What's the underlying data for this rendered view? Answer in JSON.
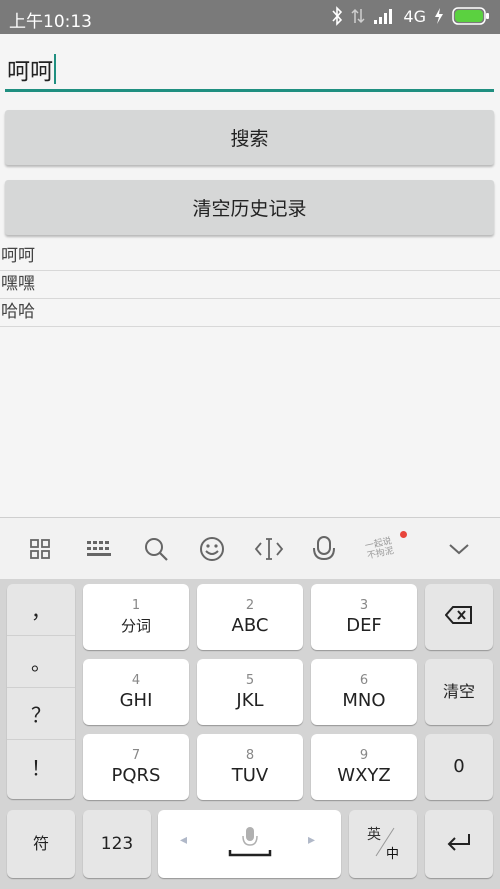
{
  "status_bar": {
    "time": "上午10:13",
    "network": "4G"
  },
  "search": {
    "value": "呵呵"
  },
  "buttons": {
    "search": "搜索",
    "clear_history": "清空历史记录"
  },
  "history": [
    "呵呵",
    "嘿嘿",
    "哈哈"
  ],
  "keyboard": {
    "toolbar_icons": [
      "grid-icon",
      "keyboard-icon",
      "search-icon",
      "emoji-icon",
      "cursor-icon",
      "microphone-icon",
      "handwriting-icon",
      "collapse-chevron-icon"
    ],
    "handwriting_hint": [
      "一起说",
      "不拘泥"
    ],
    "punctuation": [
      "，",
      "。",
      "？",
      "！"
    ],
    "keys": [
      {
        "num": "1",
        "label": "分词"
      },
      {
        "num": "2",
        "label": "ABC"
      },
      {
        "num": "3",
        "label": "DEF"
      },
      {
        "num": "4",
        "label": "GHI"
      },
      {
        "num": "5",
        "label": "JKL"
      },
      {
        "num": "6",
        "label": "MNO"
      },
      {
        "num": "7",
        "label": "PQRS"
      },
      {
        "num": "8",
        "label": "TUV"
      },
      {
        "num": "9",
        "label": "WXYZ"
      }
    ],
    "clear_key": "清空",
    "zero_key": "0",
    "symbol_key": "符",
    "numeric_key": "123",
    "lang_en": "英",
    "lang_zh": "中",
    "space_left": "◂",
    "space_right": "▸"
  },
  "colors": {
    "accent": "#1f8f80",
    "status_bar": "#7a7a7a",
    "battery": "#5bd140"
  }
}
